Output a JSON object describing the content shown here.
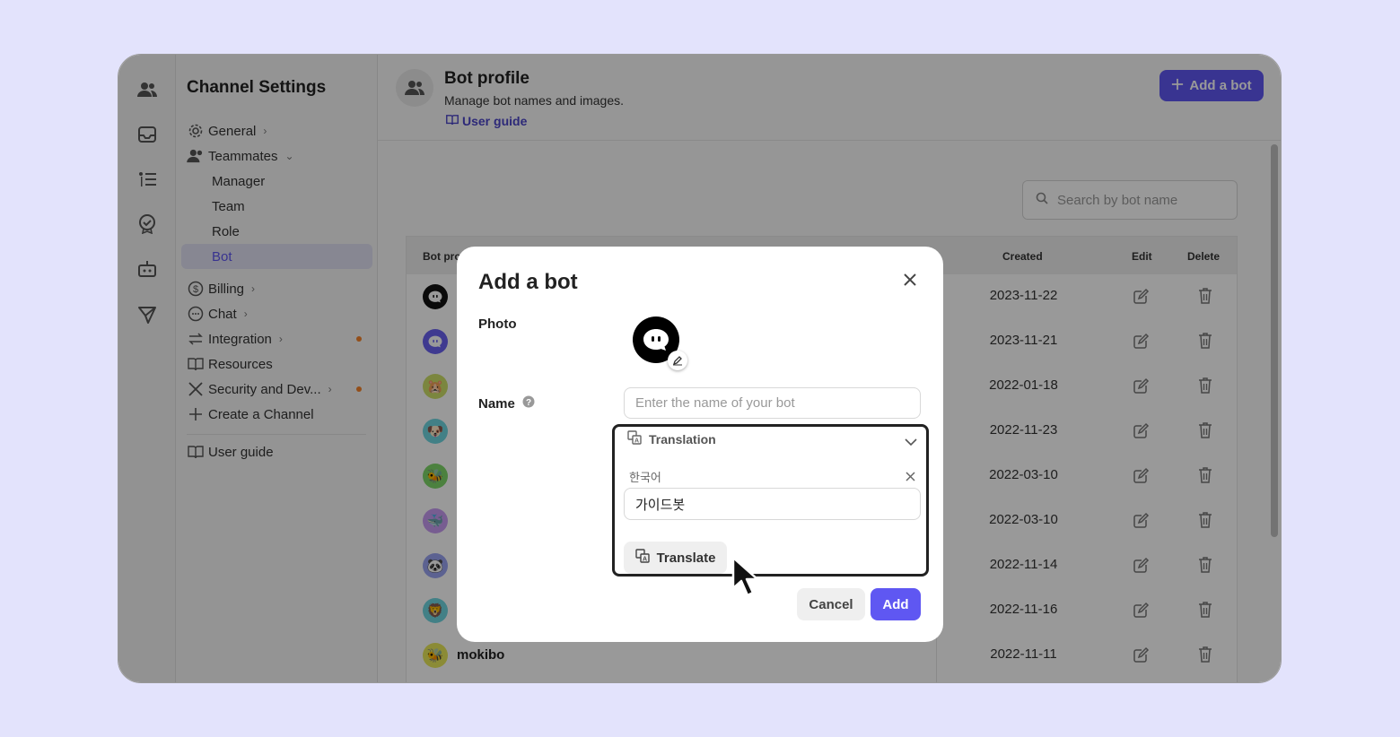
{
  "sidebar": {
    "title": "Channel Settings",
    "items": [
      {
        "label": "General"
      },
      {
        "label": "Teammates"
      },
      {
        "label": "Manager"
      },
      {
        "label": "Team"
      },
      {
        "label": "Role"
      },
      {
        "label": "Bot"
      },
      {
        "label": "Billing"
      },
      {
        "label": "Chat"
      },
      {
        "label": "Integration"
      },
      {
        "label": "Resources"
      },
      {
        "label": "Security and Dev..."
      },
      {
        "label": "Create a Channel"
      },
      {
        "label": "User guide"
      }
    ]
  },
  "header": {
    "title": "Bot profile",
    "description": "Manage bot names and images.",
    "guide_link": "User guide",
    "add_button": "Add a bot"
  },
  "search": {
    "placeholder": "Search by bot name"
  },
  "table": {
    "columns": [
      "Bot pro",
      "Created",
      "Edit",
      "Delete"
    ],
    "rows": [
      {
        "name": "",
        "created": "2023-11-22",
        "avatar": "black-bubble",
        "color": "#111111"
      },
      {
        "name": "",
        "created": "2023-11-21",
        "avatar": "purple-bubble",
        "color": "#6a62f0"
      },
      {
        "name": "",
        "created": "2022-01-18",
        "avatar": "hamster",
        "color": "#cde06a"
      },
      {
        "name": "",
        "created": "2022-11-23",
        "avatar": "dog",
        "color": "#6fd6e0"
      },
      {
        "name": "",
        "created": "2022-03-10",
        "avatar": "bee",
        "color": "#7fd86a"
      },
      {
        "name": "",
        "created": "2022-03-10",
        "avatar": "whale",
        "color": "#c79bf2"
      },
      {
        "name": "",
        "created": "2022-11-14",
        "avatar": "panda",
        "color": "#9aa4f2"
      },
      {
        "name": "",
        "created": "2022-11-16",
        "avatar": "lion",
        "color": "#6fd6e0"
      },
      {
        "name": "mokibo",
        "created": "2022-11-11",
        "avatar": "bee",
        "color": "#e8e85a"
      }
    ]
  },
  "modal": {
    "title": "Add a bot",
    "photo_label": "Photo",
    "name_label": "Name",
    "name_placeholder": "Enter the name of your bot",
    "translation_label": "Translation",
    "language": "한국어",
    "translated_value": "가이드봇",
    "translate_button": "Translate",
    "cancel_button": "Cancel",
    "add_button": "Add"
  },
  "colors": {
    "accent": "#5f57f2",
    "notification_dot": "#f5832b",
    "background": "#e3e3fc"
  }
}
